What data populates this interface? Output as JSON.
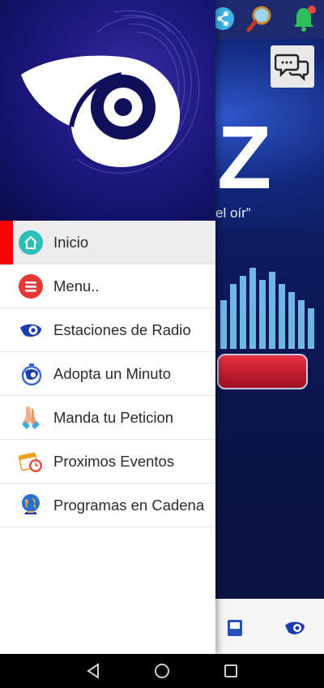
{
  "drawer": {
    "items": [
      {
        "label": "Inicio",
        "icon": "home-icon",
        "active": true
      },
      {
        "label": "Menu..",
        "icon": "menu-icon",
        "active": false
      },
      {
        "label": "Estaciones de Radio",
        "icon": "radio-logo-icon",
        "active": false
      },
      {
        "label": "Adopta un Minuto",
        "icon": "stopwatch-icon",
        "active": false
      },
      {
        "label": "Manda tu Peticion",
        "icon": "praying-hands-icon",
        "active": false
      },
      {
        "label": "Proximos Eventos",
        "icon": "calendar-clock-icon",
        "active": false
      },
      {
        "label": "Programas en Cadena",
        "icon": "globe-icon",
        "active": false
      }
    ]
  },
  "background": {
    "banner_letter": "Z",
    "banner_quote": "el oír”"
  },
  "colors": {
    "active_indicator": "#ff0000",
    "drawer_header": "#231c86",
    "home_icon": "#2bbfb7",
    "menu_icon": "#e53935"
  }
}
